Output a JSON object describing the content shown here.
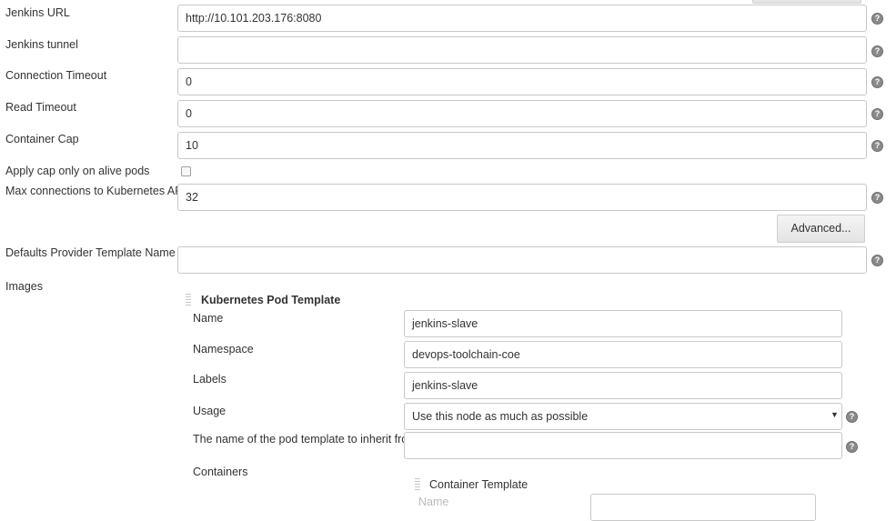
{
  "top_button_label": "",
  "global": {
    "jenkins_url": {
      "label": "Jenkins URL",
      "value": "http://10.101.203.176:8080"
    },
    "jenkins_tunnel": {
      "label": "Jenkins tunnel",
      "value": ""
    },
    "connection_timeout": {
      "label": "Connection Timeout",
      "value": "0"
    },
    "read_timeout": {
      "label": "Read Timeout",
      "value": "0"
    },
    "container_cap": {
      "label": "Container Cap",
      "value": "10"
    },
    "apply_cap": {
      "label": "Apply cap only on alive pods",
      "checked": false
    },
    "max_connections": {
      "label": "Max connections to Kubernetes API",
      "value": "32"
    },
    "advanced_label": "Advanced...",
    "defaults_provider": {
      "label": "Defaults Provider Template Name",
      "value": ""
    },
    "images_label": "Images"
  },
  "pod_template": {
    "header": "Kubernetes Pod Template",
    "name": {
      "label": "Name",
      "value": "jenkins-slave"
    },
    "namespace": {
      "label": "Namespace",
      "value": "devops-toolchain-coe"
    },
    "labels": {
      "label": "Labels",
      "value": "jenkins-slave"
    },
    "usage": {
      "label": "Usage",
      "value": "Use this node as much as possible"
    },
    "inherit": {
      "label": "The name of the pod template to inherit from",
      "value": ""
    },
    "containers_label": "Containers"
  },
  "container_template": {
    "header": "Container Template",
    "name_label": "Name"
  },
  "icons": {
    "help": "help-icon",
    "dropdown": "dropdown-caret-icon",
    "drag": "drag-handle-icon"
  },
  "colors": {
    "border": "#c8c8c8",
    "help_icon": "#8a8a8a",
    "button_bg": "#e8e8e8"
  }
}
